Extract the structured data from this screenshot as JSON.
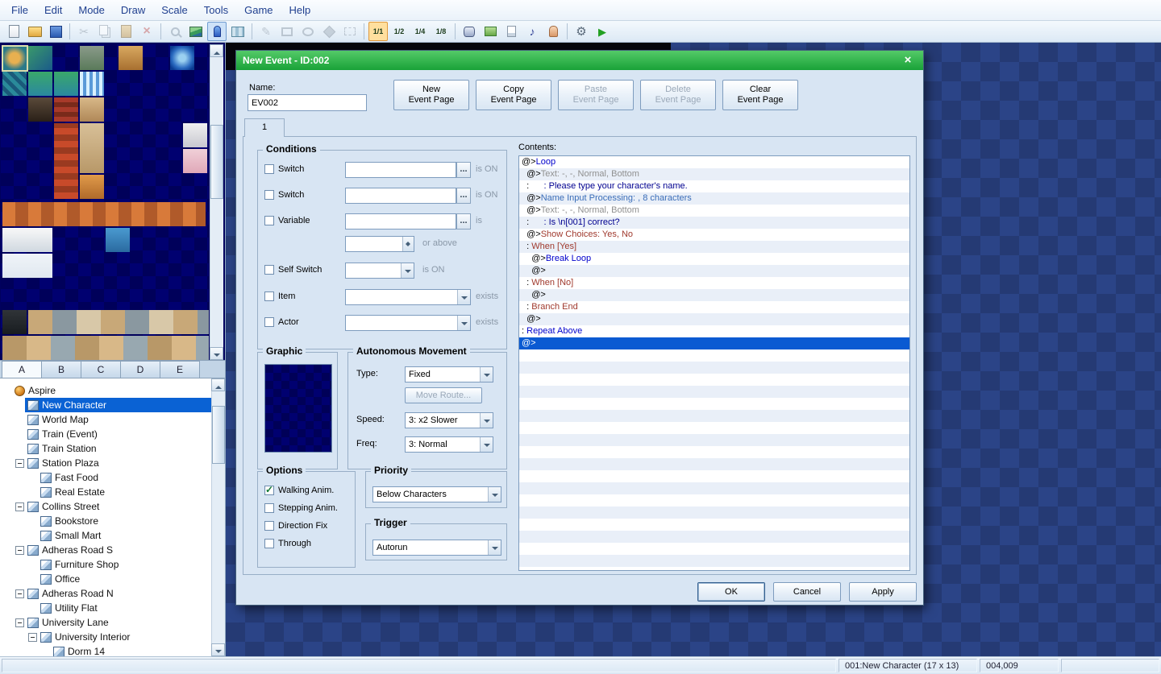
{
  "menu": {
    "items": [
      "File",
      "Edit",
      "Mode",
      "Draw",
      "Scale",
      "Tools",
      "Game",
      "Help"
    ]
  },
  "toolbar": {
    "items": [
      {
        "name": "new-file-icon"
      },
      {
        "name": "open-folder-icon"
      },
      {
        "name": "save-icon"
      },
      {
        "name": "separator"
      },
      {
        "name": "cut-icon",
        "glyph": "✂",
        "enabled": false
      },
      {
        "name": "copy-icon",
        "enabled": false
      },
      {
        "name": "paste-icon",
        "enabled": false
      },
      {
        "name": "delete-icon",
        "glyph": "×",
        "enabled": false
      },
      {
        "name": "separator"
      },
      {
        "name": "magnifier-icon",
        "enabled": false
      },
      {
        "name": "map-mode-icon"
      },
      {
        "name": "event-mode-icon",
        "active": true
      },
      {
        "name": "region-mode-icon"
      },
      {
        "name": "separator"
      },
      {
        "name": "pencil-icon",
        "glyph": "✎",
        "enabled": false
      },
      {
        "name": "rectangle-tool-icon",
        "enabled": false
      },
      {
        "name": "ellipse-tool-icon",
        "enabled": false
      },
      {
        "name": "flood-fill-icon",
        "enabled": false
      },
      {
        "name": "select-tool-icon",
        "enabled": false
      },
      {
        "name": "separator"
      },
      {
        "name": "zoom-1-1-icon",
        "label": "1/1",
        "active": true
      },
      {
        "name": "zoom-1-2-icon",
        "label": "1/2"
      },
      {
        "name": "zoom-1-4-icon",
        "label": "1/4"
      },
      {
        "name": "zoom-1-8-icon",
        "label": "1/8"
      },
      {
        "name": "separator"
      },
      {
        "name": "database-icon"
      },
      {
        "name": "materials-icon"
      },
      {
        "name": "script-editor-icon"
      },
      {
        "name": "sound-test-icon",
        "glyph": "♪"
      },
      {
        "name": "character-icon"
      },
      {
        "name": "separator"
      },
      {
        "name": "options-gear-icon",
        "glyph": "⚙"
      },
      {
        "name": "playtest-icon",
        "glyph": "▶"
      }
    ]
  },
  "palette": {
    "tabs": [
      "A",
      "B",
      "C",
      "D",
      "E"
    ],
    "active_tab": "A"
  },
  "map_tree": {
    "items": [
      {
        "label": "Aspire",
        "depth": 0,
        "icon": "project",
        "expander": "none",
        "selected": false
      },
      {
        "label": "New Character",
        "depth": 1,
        "icon": "map",
        "expander": "none",
        "selected": true
      },
      {
        "label": "World Map",
        "depth": 1,
        "icon": "map",
        "expander": "none"
      },
      {
        "label": "Train (Event)",
        "depth": 1,
        "icon": "map",
        "expander": "none"
      },
      {
        "label": "Train Station",
        "depth": 1,
        "icon": "map",
        "expander": "none"
      },
      {
        "label": "Station Plaza",
        "depth": 1,
        "icon": "map",
        "expander": "minus"
      },
      {
        "label": "Fast Food",
        "depth": 2,
        "icon": "map",
        "expander": "none"
      },
      {
        "label": "Real Estate",
        "depth": 2,
        "icon": "map",
        "expander": "none"
      },
      {
        "label": "Collins Street",
        "depth": 1,
        "icon": "map",
        "expander": "minus"
      },
      {
        "label": "Bookstore",
        "depth": 2,
        "icon": "map",
        "expander": "none"
      },
      {
        "label": "Small Mart",
        "depth": 2,
        "icon": "map",
        "expander": "none"
      },
      {
        "label": "Adheras Road S",
        "depth": 1,
        "icon": "map",
        "expander": "minus"
      },
      {
        "label": "Furniture Shop",
        "depth": 2,
        "icon": "map",
        "expander": "none"
      },
      {
        "label": "Office",
        "depth": 2,
        "icon": "map",
        "expander": "none"
      },
      {
        "label": "Adheras Road N",
        "depth": 1,
        "icon": "map",
        "expander": "minus"
      },
      {
        "label": "Utility Flat",
        "depth": 2,
        "icon": "map",
        "expander": "none"
      },
      {
        "label": "University Lane",
        "depth": 1,
        "icon": "map",
        "expander": "minus"
      },
      {
        "label": "University Interior",
        "depth": 2,
        "icon": "map",
        "expander": "minus"
      },
      {
        "label": "Dorm 14",
        "depth": 3,
        "icon": "map",
        "expander": "none"
      }
    ]
  },
  "dialog": {
    "title": "New Event - ID:002",
    "close_glyph": "×",
    "name_label": "Name:",
    "name_value": "EV002",
    "page_buttons": [
      {
        "name": "new-event-page-button",
        "line1": "New",
        "line2": "Event Page",
        "enabled": true
      },
      {
        "name": "copy-event-page-button",
        "line1": "Copy",
        "line2": "Event Page",
        "enabled": true
      },
      {
        "name": "paste-event-page-button",
        "line1": "Paste",
        "line2": "Event Page",
        "enabled": false
      },
      {
        "name": "delete-event-page-button",
        "line1": "Delete",
        "line2": "Event Page",
        "enabled": false
      },
      {
        "name": "clear-event-page-button",
        "line1": "Clear",
        "line2": "Event Page",
        "enabled": true
      }
    ],
    "tab_label": "1",
    "conditions": {
      "title": "Conditions",
      "browse_label": "...",
      "rows": {
        "switch1": {
          "label": "Switch",
          "suffix": "is ON"
        },
        "switch2": {
          "label": "Switch",
          "suffix": "is ON"
        },
        "variable": {
          "label": "Variable",
          "suffix": "is"
        },
        "variable2": {
          "suffix": "or above"
        },
        "self_switch": {
          "label": "Self Switch",
          "suffix": "is ON"
        },
        "item": {
          "label": "Item",
          "suffix": "exists"
        },
        "actor": {
          "label": "Actor",
          "suffix": "exists"
        }
      }
    },
    "graphic": {
      "title": "Graphic"
    },
    "movement": {
      "title": "Autonomous Movement",
      "type_label": "Type:",
      "type_value": "Fixed",
      "move_route_label": "Move Route...",
      "speed_label": "Speed:",
      "speed_value": "3: x2 Slower",
      "freq_label": "Freq:",
      "freq_value": "3: Normal"
    },
    "options": {
      "title": "Options",
      "items": [
        {
          "label": "Walking Anim.",
          "checked": true
        },
        {
          "label": "Stepping Anim.",
          "checked": false
        },
        {
          "label": "Direction Fix",
          "checked": false
        },
        {
          "label": "Through",
          "checked": false
        }
      ]
    },
    "priority": {
      "title": "Priority",
      "value": "Below Characters"
    },
    "trigger": {
      "title": "Trigger",
      "value": "Autorun"
    },
    "contents": {
      "label": "Contents:",
      "lines": [
        {
          "pre": "@>",
          "body": "Loop",
          "color": "#0000cc"
        },
        {
          "pre": "  @>",
          "body": "Text: -, -, Normal, Bottom",
          "color": "#909090"
        },
        {
          "pre": "  :      ",
          "body": ": Please type your character's name.",
          "color": "#000090"
        },
        {
          "pre": "  @>",
          "body": "Name Input Processing: , 8 characters",
          "color": "#3a6db8"
        },
        {
          "pre": "  @>",
          "body": "Text: -, -, Normal, Bottom",
          "color": "#909090"
        },
        {
          "pre": "  :      ",
          "body": ": Is \\n[001] correct?",
          "color": "#000090"
        },
        {
          "pre": "  @>",
          "body": "Show Choices: Yes, No",
          "color": "#a03a2e"
        },
        {
          "pre": "  : ",
          "body": "When [Yes]",
          "color": "#a03a2e"
        },
        {
          "pre": "    @>",
          "body": "Break Loop",
          "color": "#0000cc"
        },
        {
          "pre": "    @>",
          "body": "",
          "color": "#000000"
        },
        {
          "pre": "  : ",
          "body": "When [No]",
          "color": "#a03a2e"
        },
        {
          "pre": "    @>",
          "body": "",
          "color": "#000000"
        },
        {
          "pre": "  : ",
          "body": "Branch End",
          "color": "#a03a2e"
        },
        {
          "pre": "  @>",
          "body": "",
          "color": "#000000"
        },
        {
          "pre": ": ",
          "body": "Repeat Above",
          "color": "#0000cc"
        },
        {
          "pre": "@>",
          "body": "",
          "color": "#000000",
          "selected": true
        }
      ]
    },
    "buttons": {
      "ok": "OK",
      "cancel": "Cancel",
      "apply": "Apply"
    }
  },
  "status_bar": {
    "map_info": "001:New Character (17 x 13)",
    "coords": "004,009"
  },
  "colors": {
    "titlebar_green": "#2eb449",
    "selection_blue": "#0a62d4",
    "map_background": "#283f7d"
  }
}
